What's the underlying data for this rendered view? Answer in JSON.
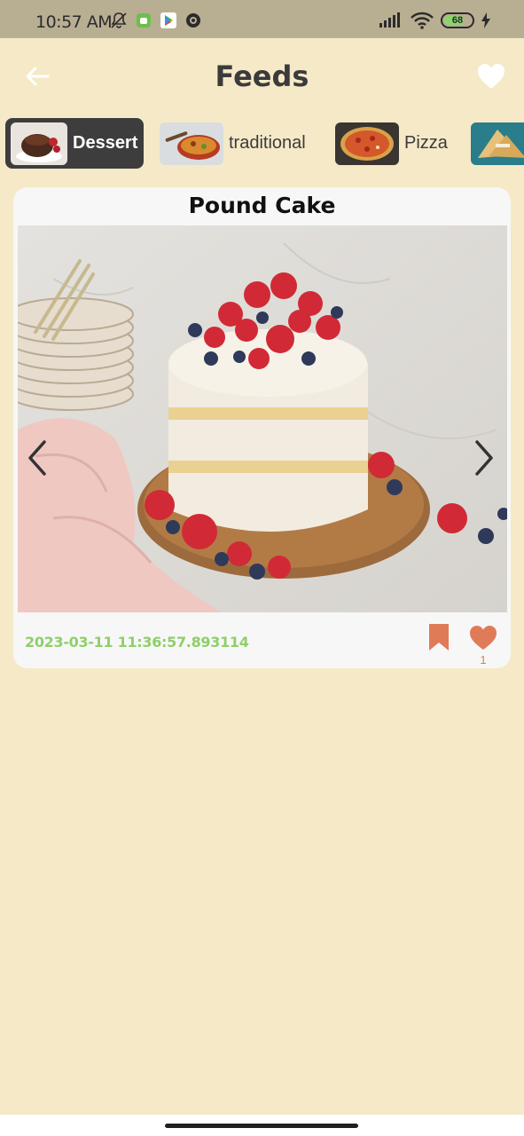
{
  "status_bar": {
    "time": "10:57 AM",
    "battery_level": "68",
    "left_icons": [
      "mute-icon",
      "android-icon",
      "play-store-icon",
      "app-icon"
    ],
    "right_icons": [
      "signal-icon",
      "wifi-icon",
      "battery-icon",
      "charging-icon"
    ]
  },
  "app_bar": {
    "title": "Feeds",
    "back_icon": "arrow-left-icon",
    "favorites_icon": "heart-icon"
  },
  "categories": [
    {
      "label": "Dessert",
      "selected": true
    },
    {
      "label": "traditional",
      "selected": false
    },
    {
      "label": "Pizza",
      "selected": false
    },
    {
      "label": "",
      "selected": false
    }
  ],
  "feed": [
    {
      "title": "Pound Cake",
      "timestamp": "2023-03-11 11:36:57.893114",
      "likes": "1",
      "bookmark_icon": "bookmark-icon",
      "like_icon": "heart-icon"
    }
  ],
  "colors": {
    "background": "#f5e9c7",
    "status_bar": "#b8ae92",
    "card": "#f7f7f7",
    "accent": "#e07b57",
    "timestamp": "#8fcf6a",
    "chip_selected": "#3d3d3d"
  }
}
